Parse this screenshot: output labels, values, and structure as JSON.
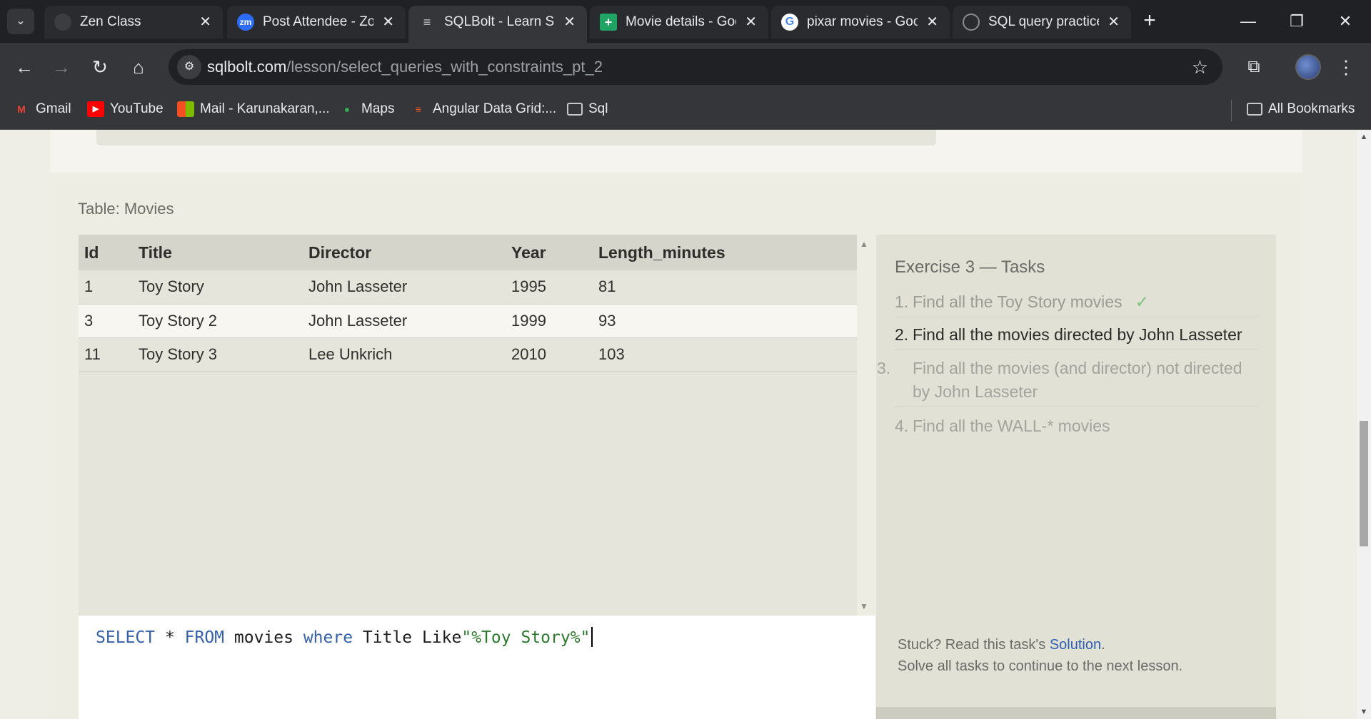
{
  "browser": {
    "tabs": [
      {
        "label": "Zen Class",
        "icon": "zen-class-icon",
        "active": false
      },
      {
        "label": "Post Attendee - Zoom",
        "icon": "zoom-icon",
        "active": false
      },
      {
        "label": "SQLBolt - Learn SQL",
        "icon": "database-icon",
        "active": true
      },
      {
        "label": "Movie details - Google Sheets",
        "icon": "sheets-icon",
        "active": false
      },
      {
        "label": "pixar movies - Google Search",
        "icon": "google-icon",
        "active": false
      },
      {
        "label": "SQL query practice",
        "icon": "github-icon",
        "active": false
      }
    ],
    "url_host": "sqlbolt.com",
    "url_path": "/lesson/select_queries_with_constraints_pt_2",
    "bookmarks": [
      {
        "label": "Gmail",
        "icon": "gmail-icon"
      },
      {
        "label": "YouTube",
        "icon": "youtube-icon"
      },
      {
        "label": "Mail - Karunakaran,...",
        "icon": "microsoft-icon"
      },
      {
        "label": "Maps",
        "icon": "maps-icon"
      },
      {
        "label": "Angular Data Grid:...",
        "icon": "ag-grid-icon"
      },
      {
        "label": "Sql",
        "icon": "folder-icon"
      }
    ],
    "all_bookmarks_label": "All Bookmarks"
  },
  "exercise": {
    "table_caption": "Table: Movies",
    "columns": [
      "Id",
      "Title",
      "Director",
      "Year",
      "Length_minutes"
    ],
    "rows": [
      [
        "1",
        "Toy Story",
        "John Lasseter",
        "1995",
        "81"
      ],
      [
        "3",
        "Toy Story 2",
        "John Lasseter",
        "1999",
        "93"
      ],
      [
        "11",
        "Toy Story 3",
        "Lee Unkrich",
        "2010",
        "103"
      ]
    ],
    "query": {
      "kw_select": "SELECT",
      "star": " * ",
      "kw_from": "FROM",
      "table": " movies ",
      "kw_where": "where",
      "rest": " Title Like",
      "literal": "\"%Toy Story%\""
    },
    "tasks_title": "Exercise 3 — Tasks",
    "tasks": [
      {
        "num": "1.",
        "text": "Find all the Toy Story movies",
        "state": "done",
        "check": "✓"
      },
      {
        "num": "2.",
        "text": "Find all the movies directed by John Lasseter",
        "state": "current"
      },
      {
        "num": "3.",
        "text": "Find all the movies (and director) not directed by John Lasseter",
        "state": "pending"
      },
      {
        "num": "4.",
        "text": "Find all the WALL-* movies",
        "state": "pending"
      }
    ],
    "stuck_prefix": "Stuck? Read this task's ",
    "solution_link": "Solution",
    "stuck_suffix": ".",
    "continue_note": "Solve all tasks to continue to the next lesson."
  }
}
